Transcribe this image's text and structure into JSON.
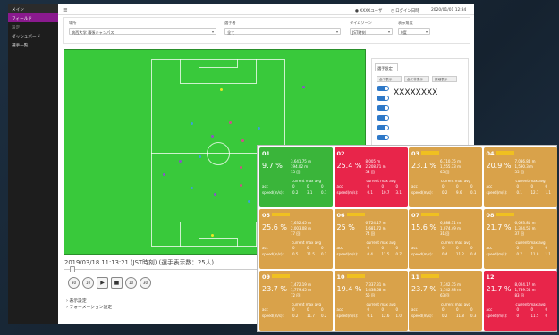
{
  "sidebar": {
    "items": [
      {
        "label": "メイン",
        "state": "head"
      },
      {
        "label": "フィールド",
        "state": "active"
      },
      {
        "label": "設定",
        "state": "sub"
      },
      {
        "label": "ダッシュボード",
        "state": "normal"
      },
      {
        "label": "選手一覧",
        "state": "normal"
      }
    ]
  },
  "topbar": {
    "user": "XXXXユーザ",
    "logout": "ログイン日時",
    "clock": "2020/01/01 12:34"
  },
  "filters": {
    "place_label": "場所",
    "place_value": "筑西大学 幕張キャンパス",
    "player_label": "選手者",
    "player_value": "全て",
    "timezone_label": "タイムゾーン",
    "timezone_value": "JST時刻",
    "display_label": "表示角度",
    "display_value": "0度"
  },
  "panel": {
    "tab": "選手設定",
    "btn1": "全て表示",
    "btn2": "全て非表示",
    "btn3": "詳細表示",
    "selected": "XXXXXXXX"
  },
  "timeinfo": "2019/03/18 11:13:21 (JST時刻) (選手表示数：25人)",
  "controls": {
    "b30": "30",
    "b10": "10",
    "play": "▶",
    "stop": "■",
    "f10": "10",
    "f30": "30"
  },
  "links": {
    "l1": "表示設定",
    "l2": "フォーメーション設定"
  },
  "field_dots": [
    {
      "c": "#e8e824"
    },
    {
      "c": "#8a52c8"
    },
    {
      "c": "#3aa0d8"
    },
    {
      "c": "#d44b8a"
    },
    {
      "c": "#3aa0d8"
    },
    {
      "c": "#8a52c8"
    },
    {
      "c": "#d44b8a"
    },
    {
      "c": "#3aa0d8"
    },
    {
      "c": "#8a52c8"
    },
    {
      "c": "#d44b8a"
    },
    {
      "c": "#8a52c8"
    },
    {
      "c": "#3aa0d8"
    },
    {
      "c": "#d44b8a"
    },
    {
      "c": "#8a52c8"
    },
    {
      "c": "#3aa0d8"
    },
    {
      "c": "#e8e824"
    }
  ],
  "cards": [
    {
      "no": "01",
      "pct": "9.7 %",
      "dist": "3,641.75 m",
      "speed": "194.02 m",
      "count": "13 回",
      "max": "3.1",
      "cur": "0.2",
      "avg": "0.1",
      "color": "#3ab53a",
      "tag": "#3ab53a"
    },
    {
      "no": "02",
      "pct": "25.4 %",
      "dist": "8,005 m",
      "speed": "2,208.71 m",
      "count": "34 回",
      "max": "10.7",
      "cur": "0.1",
      "avg": "3.1",
      "color": "#e8254a",
      "tag": "#e8254a"
    },
    {
      "no": "03",
      "pct": "23.1 %",
      "dist": "6,710.75 m",
      "speed": "1,555.33 m",
      "count": "63 回",
      "max": "9.6",
      "cur": "0.2",
      "avg": "0.1",
      "color": "#d9a24a",
      "tag": "#f0c020"
    },
    {
      "no": "04",
      "pct": "20.9 %",
      "dist": "7,036.84 m",
      "speed": "1,590.3 m",
      "count": "33 回",
      "max": "12.1",
      "cur": "0.1",
      "avg": "1.1",
      "color": "#d9a24a",
      "tag": "#f0c020"
    },
    {
      "no": "05",
      "pct": "25.6 %",
      "dist": "7,632.45 m",
      "speed": "2,003.08 m",
      "count": "77 回",
      "max": "11.5",
      "cur": "0.5",
      "avg": "0.2",
      "color": "#d9a24a",
      "tag": "#f0c020"
    },
    {
      "no": "06",
      "pct": "25 %",
      "dist": "6,724.17 m",
      "speed": "1,681.72 m",
      "count": "74 回",
      "max": "11.5",
      "cur": "0.4",
      "avg": "0.7",
      "color": "#d9a24a",
      "tag": "#f0c020"
    },
    {
      "no": "07",
      "pct": "15.6 %",
      "dist": "6,888.11 m",
      "speed": "1,074.49 m",
      "count": "31 回",
      "max": "11.2",
      "cur": "0.4",
      "avg": "0.4",
      "color": "#d9a24a",
      "tag": "#f0c020"
    },
    {
      "no": "08",
      "pct": "21.7 %",
      "dist": "6,093.81 m",
      "speed": "1,324.56 m",
      "count": "37 回",
      "max": "11.8",
      "cur": "0.7",
      "avg": "1.1",
      "color": "#d9a24a",
      "tag": "#f0c020"
    },
    {
      "no": "09",
      "pct": "23.7 %",
      "dist": "7,472.19 m",
      "speed": "1,779.45 m",
      "count": "72 回",
      "max": "11.7",
      "cur": "0.2",
      "avg": "0.2",
      "color": "#d9a24a",
      "tag": "#f0c020"
    },
    {
      "no": "10",
      "pct": "19.4 %",
      "dist": "7,337.31 m",
      "speed": "1,438.68 m",
      "count": "56 回",
      "max": "12.6",
      "cur": "0.1",
      "avg": "1.0",
      "color": "#d9a24a",
      "tag": "#f0c020"
    },
    {
      "no": "11",
      "pct": "23.7 %",
      "dist": "7,342.75 m",
      "speed": "1,742.98 m",
      "count": "63 回",
      "max": "11.8",
      "cur": "0.2",
      "avg": "0.3",
      "color": "#d9a24a",
      "tag": "#f0c020"
    },
    {
      "no": "12",
      "pct": "21.7 %",
      "dist": "8,024.17 m",
      "speed": "1,739.54 m",
      "count": "83 回",
      "max": "11.5",
      "cur": "0",
      "avg": "0",
      "color": "#e8254a",
      "tag": "#e8254a"
    }
  ],
  "card_labels": {
    "hdr": "current  max  avg",
    "acc": "acc",
    "speed": "speed(m/s):",
    "zero": "0"
  }
}
